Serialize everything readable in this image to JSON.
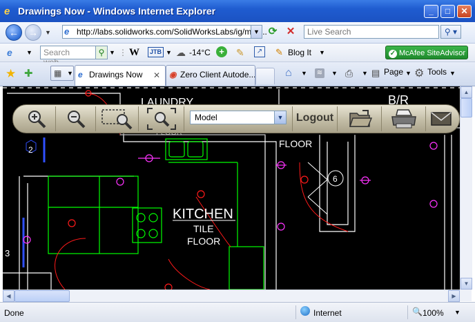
{
  "window": {
    "title": "Drawings Now - Windows Internet Explorer"
  },
  "address_bar": {
    "url": "http://labs.solidworks.com/SolidWorksLabs/ig/main..",
    "search_placeholder": "Live Search"
  },
  "links_toolbar": {
    "search_placeholder": "Search web...",
    "temperature": "-14°C",
    "blog_it": "Blog It",
    "mcafee": "McAfee SiteAdvisor"
  },
  "tabs": [
    {
      "label": "Drawings Now"
    },
    {
      "label": "Zero Client Autode..."
    }
  ],
  "command_bar": {
    "page": "Page",
    "tools": "Tools"
  },
  "app_toolbar": {
    "view_select": "Model",
    "logout": "Logout"
  },
  "drawing": {
    "labels": {
      "laundry": "LAUNDRY",
      "floor_a": "FLOOR",
      "floor_b": "FLOOR",
      "kitchen": "KITCHEN",
      "tile": "TILE",
      "floor_c": "FLOOR",
      "br": "B/R",
      "tag_2": "2",
      "tag_3": "3",
      "tag_6": "6"
    }
  },
  "status_bar": {
    "status": "Done",
    "zone": "Internet",
    "zoom": "100%"
  },
  "colors": {
    "cad_background": "#000000",
    "walls": "#ffffff",
    "fixtures": "#00ff00",
    "electrical": "#ff0000",
    "outlets": "#ff00ff",
    "xp_blue": "#1f5cd0"
  }
}
